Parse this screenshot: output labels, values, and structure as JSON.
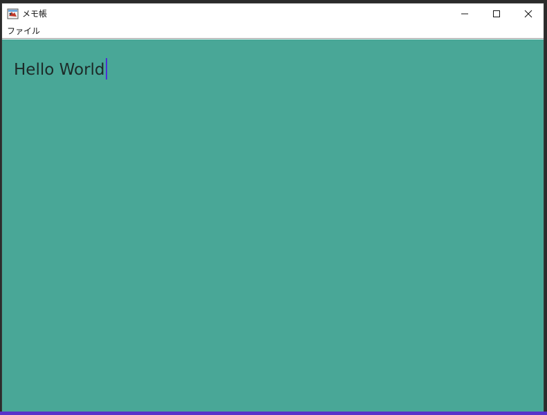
{
  "window": {
    "title": "メモ帳",
    "app_icon": "notepad-app-icon"
  },
  "controls": {
    "minimize_icon": "minimize-icon",
    "maximize_icon": "maximize-icon",
    "close_icon": "close-icon"
  },
  "menu": {
    "items": [
      {
        "label": "ファイル"
      }
    ]
  },
  "editor": {
    "text": "Hello World",
    "background": "#49a797",
    "caret_color": "#4b2fd6"
  },
  "colors": {
    "accent_strip": "#5933c9"
  }
}
